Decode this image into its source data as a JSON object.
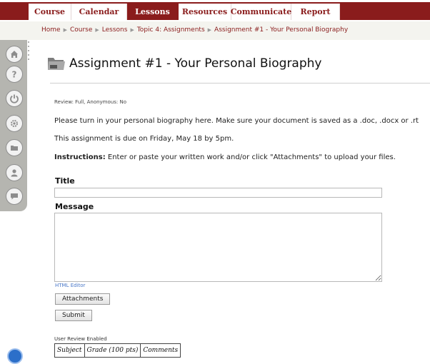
{
  "nav": {
    "tabs": [
      {
        "label": "Course"
      },
      {
        "label": "Calendar"
      },
      {
        "label": "Lessons"
      },
      {
        "label": "Resources"
      },
      {
        "label": "Communicate"
      },
      {
        "label": "Report"
      }
    ],
    "active_tab": "Lessons"
  },
  "breadcrumb": {
    "items": [
      "Home",
      "Course",
      "Lessons",
      "Topic 4: Assignments",
      "Assignment #1 - Your Personal Biography"
    ],
    "separator": "▶"
  },
  "sidebar": {
    "icons": [
      "home-icon",
      "help-icon",
      "power-icon",
      "gear-icon",
      "folder-icon",
      "user-icon",
      "chat-icon"
    ]
  },
  "page": {
    "title": "Assignment #1 - Your Personal Biography",
    "review": "Review: Full, Anonymous: No",
    "line1": "Please turn in your personal biography here.  Make sure your document is saved as a .doc, .docx or .rt",
    "line2": "This assignment is due on Friday, May 18 by 5pm.",
    "instructions_label": "Instructions:",
    "instructions_text": " Enter or paste your written work and/or click \"Attachments\" to upload your files."
  },
  "form": {
    "title_label": "Title",
    "title_value": "",
    "message_label": "Message",
    "message_value": "",
    "html_editor_link": "HTML Editor",
    "attachments_button": "Attachments",
    "submit_button": "Submit"
  },
  "user_review": {
    "label": "User Review Enabled",
    "columns": [
      "Subject",
      "Grade (100 pts)",
      "Comments"
    ]
  },
  "colors": {
    "brand": "#8a1c1c",
    "link": "#4a78c8"
  }
}
